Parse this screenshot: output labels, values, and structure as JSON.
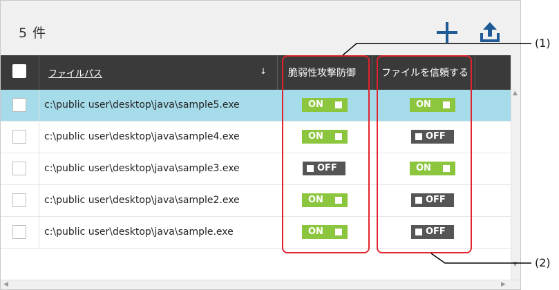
{
  "header": {
    "count_label": "5 件",
    "columns": {
      "path": "ファイルパス",
      "sort_indicator": "↓",
      "vuln": "脆弱性攻撃防御",
      "trust": "ファイルを信頼する"
    }
  },
  "icons": {
    "add": "plus-icon",
    "upload": "upload-icon"
  },
  "rows": [
    {
      "path": "c:\\public user\\desktop\\java\\sample5.exe",
      "vuln": "ON",
      "trust": "ON",
      "selected": true
    },
    {
      "path": "c:\\public user\\desktop\\java\\sample4.exe",
      "vuln": "ON",
      "trust": "OFF",
      "selected": false
    },
    {
      "path": "c:\\public user\\desktop\\java\\sample3.exe",
      "vuln": "OFF",
      "trust": "ON",
      "selected": false
    },
    {
      "path": "c:\\public user\\desktop\\java\\sample2.exe",
      "vuln": "ON",
      "trust": "OFF",
      "selected": false
    },
    {
      "path": "c:\\public user\\desktop\\java\\sample.exe",
      "vuln": "ON",
      "trust": "OFF",
      "selected": false
    }
  ],
  "callouts": {
    "one": "(1)",
    "two": "(2)"
  },
  "colors": {
    "on": "#8cc63e",
    "off": "#555555",
    "selected_row": "#a6dcea",
    "header": "#3a3a3a",
    "highlight": "#e0242d",
    "toolbar_icon": "#1e5a96"
  }
}
